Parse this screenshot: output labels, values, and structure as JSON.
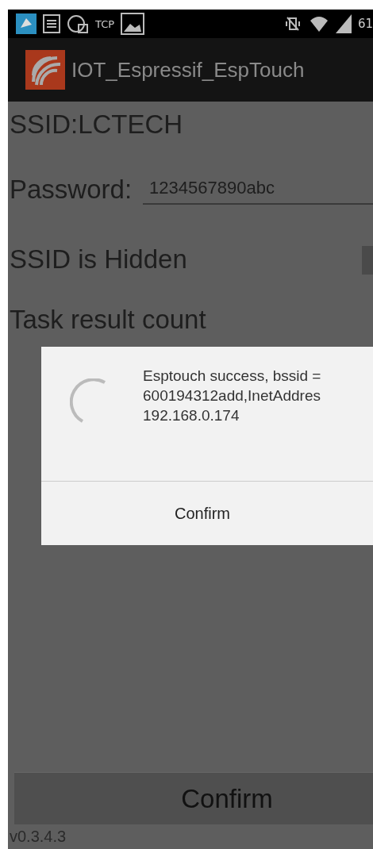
{
  "status_bar": {
    "label": "TCP",
    "signal_text": "61"
  },
  "app_bar": {
    "title": "IOT_Espressif_EspTouch"
  },
  "form": {
    "ssid": "SSID:LCTECH",
    "password_label": "Password:",
    "password_value": "1234567890abc",
    "hidden_label": "SSID is Hidden",
    "hidden_checked": false,
    "count_label": "Task result count"
  },
  "dialog": {
    "lines": [
      "Esptouch success, bssid =",
      "600194312add,InetAddres",
      "192.168.0.174"
    ],
    "button": "Confirm"
  },
  "confirm_button": "Confirm",
  "version": "v0.3.4.3"
}
